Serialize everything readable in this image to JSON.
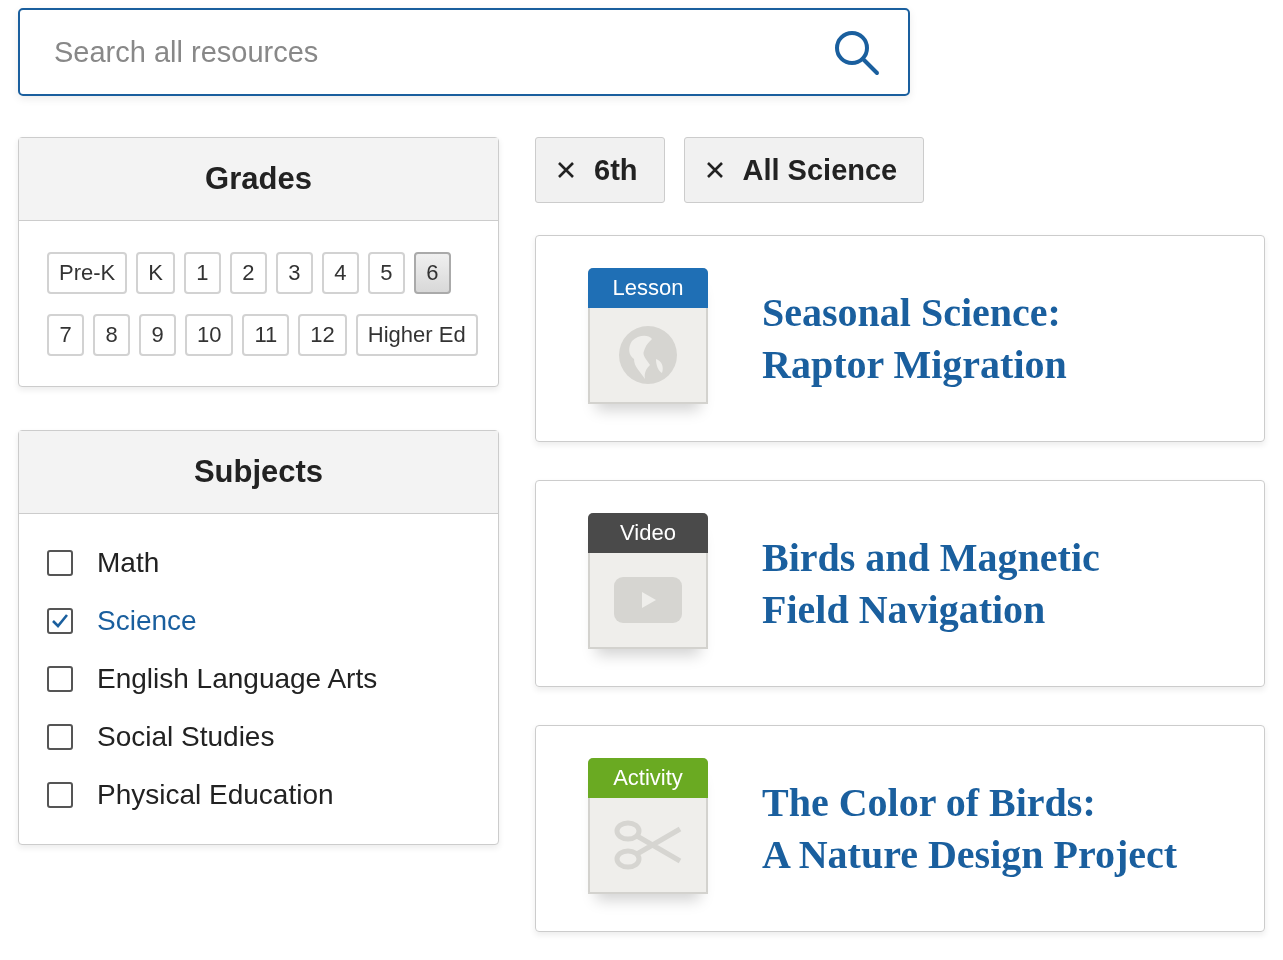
{
  "search": {
    "placeholder": "Search all resources"
  },
  "grades": {
    "title": "Grades",
    "items": [
      {
        "label": "Pre-K",
        "selected": false
      },
      {
        "label": "K",
        "selected": false
      },
      {
        "label": "1",
        "selected": false
      },
      {
        "label": "2",
        "selected": false
      },
      {
        "label": "3",
        "selected": false
      },
      {
        "label": "4",
        "selected": false
      },
      {
        "label": "5",
        "selected": false
      },
      {
        "label": "6",
        "selected": true
      },
      {
        "label": "7",
        "selected": false
      },
      {
        "label": "8",
        "selected": false
      },
      {
        "label": "9",
        "selected": false
      },
      {
        "label": "10",
        "selected": false
      },
      {
        "label": "11",
        "selected": false
      },
      {
        "label": "12",
        "selected": false
      },
      {
        "label": "Higher Ed",
        "selected": false
      }
    ]
  },
  "subjects": {
    "title": "Subjects",
    "items": [
      {
        "label": "Math",
        "checked": false
      },
      {
        "label": "Science",
        "checked": true
      },
      {
        "label": "English Language Arts",
        "checked": false
      },
      {
        "label": "Social Studies",
        "checked": false
      },
      {
        "label": "Physical Education",
        "checked": false
      }
    ]
  },
  "active_filters": [
    "6th",
    "All Science"
  ],
  "results": [
    {
      "kind": "lesson",
      "tag": "Lesson",
      "color": "#1f6fb5",
      "title_lines": [
        "Seasonal Science:",
        "Raptor Migration"
      ]
    },
    {
      "kind": "video",
      "tag": "Video",
      "color": "#4a4a4a",
      "title_lines": [
        "Birds and Magnetic",
        "Field Navigation"
      ]
    },
    {
      "kind": "activity",
      "tag": "Activity",
      "color": "#6aaa22",
      "title_lines": [
        "The Color of Birds:",
        "A Nature Design Project"
      ]
    }
  ]
}
